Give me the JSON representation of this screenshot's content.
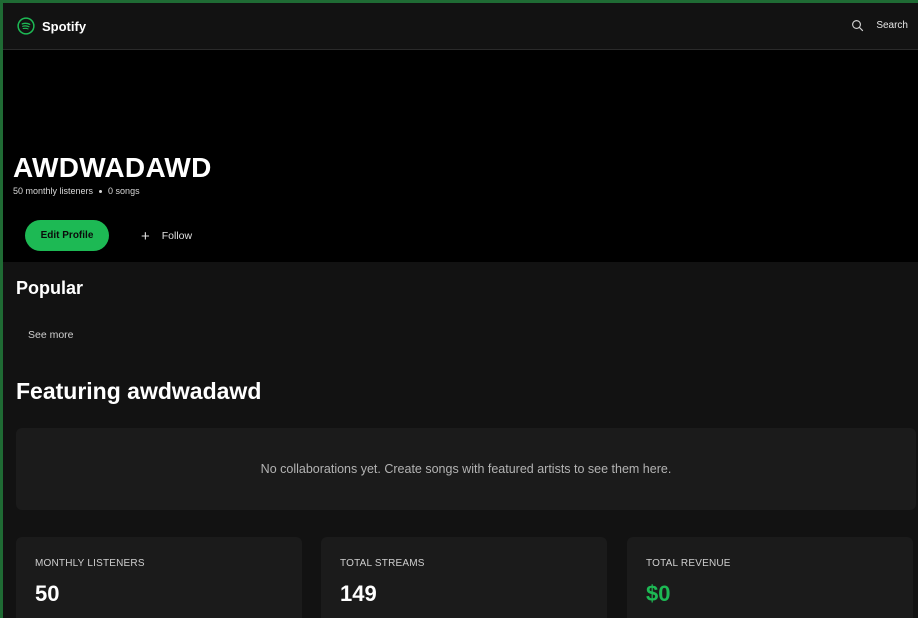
{
  "app": {
    "name": "Spotify",
    "accent": "#1db954"
  },
  "header": {
    "search_label": "Search"
  },
  "artist": {
    "name": "AWDWADAWD",
    "monthly_listeners_text": "50 monthly listeners",
    "songs_text": "0 songs",
    "edit_label": "Edit Profile",
    "follow_label": "Follow"
  },
  "popular": {
    "title": "Popular",
    "see_more": "See more"
  },
  "featuring": {
    "title": "Featuring awdwadawd",
    "empty_text": "No collaborations yet. Create songs with featured artists to see them here."
  },
  "stats": [
    {
      "label": "MONTHLY LISTENERS",
      "value": "50"
    },
    {
      "label": "TOTAL STREAMS",
      "value": "149"
    },
    {
      "label": "TOTAL REVENUE",
      "value": "$0"
    }
  ]
}
